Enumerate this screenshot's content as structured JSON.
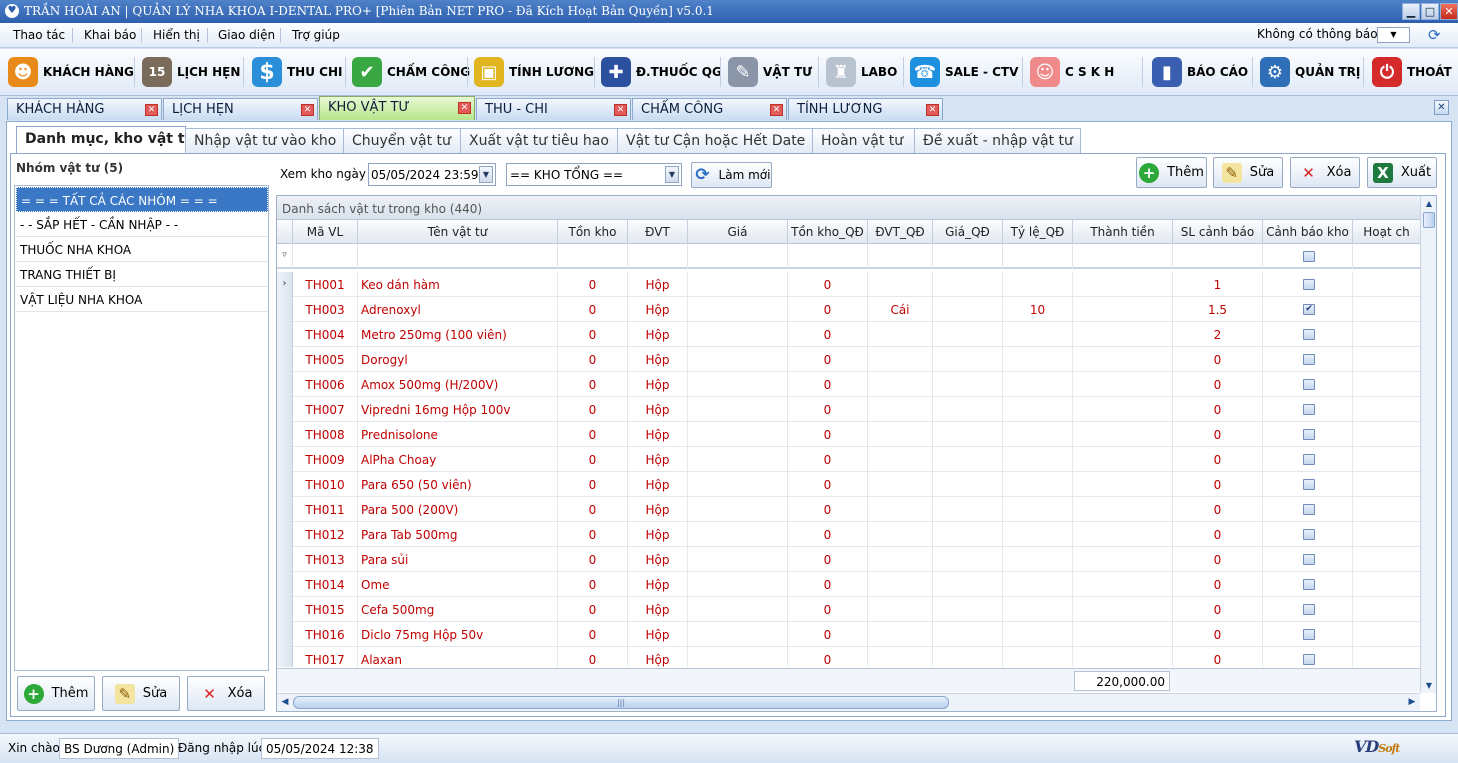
{
  "window": {
    "title": "TRẦN HOÀI AN | QUẢN LÝ NHA KHOA I-DENTAL PRO+ [Phiên Bản NET PRO - Đã Kích Hoạt Bản Quyền] v5.0.1",
    "buttons": {
      "minimize": "▁",
      "maximize": "□",
      "close": "✕"
    }
  },
  "menu": {
    "items": [
      "Thao tác",
      "Khai báo",
      "Hiển thị",
      "Giao diện",
      "Trợ giúp"
    ],
    "notification": "Không có thông báo"
  },
  "toolbar": {
    "items": [
      {
        "label": "KHÁCH HÀNG",
        "icon": "people-icon",
        "color": "#e88a1a"
      },
      {
        "label": "LỊCH HẸN",
        "icon": "calendar-icon",
        "color": "#7b6b5b"
      },
      {
        "label": "THU CHI",
        "icon": "dollar-icon",
        "color": "#2a8fd8"
      },
      {
        "label": "CHẤM CÔNG",
        "icon": "shield-check-icon",
        "color": "#3aa842"
      },
      {
        "label": "TÍNH LƯƠNG",
        "icon": "wallet-icon",
        "color": "#e0b520"
      },
      {
        "label": "Đ.THUỐC QG",
        "icon": "medicine-icon",
        "color": "#2c4fa0"
      },
      {
        "label": "VẬT TƯ",
        "icon": "syringe-icon",
        "color": "#8a96a8"
      },
      {
        "label": "LABO",
        "icon": "tooth-icon",
        "color": "#b9c3cf"
      },
      {
        "label": "SALE - CTV",
        "icon": "phone-icon",
        "color": "#1f8fe0"
      },
      {
        "label": "C S K H",
        "icon": "support-icon",
        "color": "#f08a8a"
      },
      {
        "label": "BÁO CÁO",
        "icon": "report-chart-icon",
        "color": "#3a5fb0"
      },
      {
        "label": "QUẢN TRỊ",
        "icon": "gear-icon",
        "color": "#2f6fb8"
      },
      {
        "label": "THOÁT",
        "icon": "power-icon",
        "color": "#d42a2a"
      }
    ]
  },
  "doc_tabs": [
    "KHÁCH HÀNG",
    "LỊCH HẸN",
    "KHO VẬT TƯ",
    "THU - CHI",
    "CHẤM CÔNG",
    "TÍNH LƯƠNG"
  ],
  "active_doc_tab": "KHO VẬT TƯ",
  "sub_tabs": [
    "Danh mục, kho vật tư",
    "Nhập vật tư vào kho",
    "Chuyển vật tư",
    "Xuất vật tư tiêu hao",
    "Vật tư Cận hoặc Hết Date",
    "Hoàn vật tư",
    "Đề xuất - nhập vật tư"
  ],
  "left": {
    "header": "Nhóm vật tư (5)",
    "groups": [
      "= = = TẤT CẢ CÁC NHÓM = = =",
      "- - SẮP HẾT - CẦN NHẬP - -",
      "THUỐC NHA KHOA",
      "TRANG THIẾT BỊ",
      "VẬT LIỆU NHA KHOA"
    ],
    "buttons": {
      "add": "Thêm",
      "edit": "Sửa",
      "delete": "Xóa"
    }
  },
  "filters": {
    "date_label": "Xem kho ngày",
    "date_value": "05/05/2024 23:59",
    "warehouse_value": "== KHO TỔNG ==",
    "refresh": "Làm mới"
  },
  "actions": {
    "add": "Thêm",
    "edit": "Sửa",
    "delete": "Xóa",
    "export": "Xuất"
  },
  "grid": {
    "caption": "Danh sách vật tư trong kho (440)",
    "columns": [
      "Mã VL",
      "Tên vật tư",
      "Tồn kho",
      "ĐVT",
      "Giá",
      "Tồn kho_QĐ",
      "ĐVT_QĐ",
      "Giá_QĐ",
      "Tỷ lệ_QĐ",
      "Thành tiền",
      "SL cảnh báo",
      "Cảnh báo kho",
      "Hoạt ch"
    ],
    "rows": [
      {
        "code": "TH001",
        "name": "Keo dán hàm",
        "stock": "0",
        "unit": "Hộp",
        "price": "",
        "stock_qd": "0",
        "unit_qd": "",
        "price_qd": "",
        "ratio_qd": "",
        "total": "",
        "warn_qty": "1",
        "warn": false
      },
      {
        "code": "TH003",
        "name": "Adrenoxyl",
        "stock": "0",
        "unit": "Hộp",
        "price": "",
        "stock_qd": "0",
        "unit_qd": "Cái",
        "price_qd": "",
        "ratio_qd": "10",
        "total": "",
        "warn_qty": "1.5",
        "warn": true
      },
      {
        "code": "TH004",
        "name": "Metro 250mg (100 viên)",
        "stock": "0",
        "unit": "Hộp",
        "price": "",
        "stock_qd": "0",
        "unit_qd": "",
        "price_qd": "",
        "ratio_qd": "",
        "total": "",
        "warn_qty": "2",
        "warn": false
      },
      {
        "code": "TH005",
        "name": "Dorogyl",
        "stock": "0",
        "unit": "Hộp",
        "price": "",
        "stock_qd": "0",
        "unit_qd": "",
        "price_qd": "",
        "ratio_qd": "",
        "total": "",
        "warn_qty": "0",
        "warn": false
      },
      {
        "code": "TH006",
        "name": "Amox 500mg (H/200V)",
        "stock": "0",
        "unit": "Hộp",
        "price": "",
        "stock_qd": "0",
        "unit_qd": "",
        "price_qd": "",
        "ratio_qd": "",
        "total": "",
        "warn_qty": "0",
        "warn": false
      },
      {
        "code": "TH007",
        "name": "Vipredni 16mg Hộp 100v",
        "stock": "0",
        "unit": "Hộp",
        "price": "",
        "stock_qd": "0",
        "unit_qd": "",
        "price_qd": "",
        "ratio_qd": "",
        "total": "",
        "warn_qty": "0",
        "warn": false
      },
      {
        "code": "TH008",
        "name": "Prednisolone",
        "stock": "0",
        "unit": "Hộp",
        "price": "",
        "stock_qd": "0",
        "unit_qd": "",
        "price_qd": "",
        "ratio_qd": "",
        "total": "",
        "warn_qty": "0",
        "warn": false
      },
      {
        "code": "TH009",
        "name": "AlPha Choay",
        "stock": "0",
        "unit": "Hộp",
        "price": "",
        "stock_qd": "0",
        "unit_qd": "",
        "price_qd": "",
        "ratio_qd": "",
        "total": "",
        "warn_qty": "0",
        "warn": false
      },
      {
        "code": "TH010",
        "name": "Para 650 (50 viên)",
        "stock": "0",
        "unit": "Hộp",
        "price": "",
        "stock_qd": "0",
        "unit_qd": "",
        "price_qd": "",
        "ratio_qd": "",
        "total": "",
        "warn_qty": "0",
        "warn": false
      },
      {
        "code": "TH011",
        "name": "Para 500 (200V)",
        "stock": "0",
        "unit": "Hộp",
        "price": "",
        "stock_qd": "0",
        "unit_qd": "",
        "price_qd": "",
        "ratio_qd": "",
        "total": "",
        "warn_qty": "0",
        "warn": false
      },
      {
        "code": "TH012",
        "name": "Para Tab 500mg",
        "stock": "0",
        "unit": "Hộp",
        "price": "",
        "stock_qd": "0",
        "unit_qd": "",
        "price_qd": "",
        "ratio_qd": "",
        "total": "",
        "warn_qty": "0",
        "warn": false
      },
      {
        "code": "TH013",
        "name": "Para sủi",
        "stock": "0",
        "unit": "Hộp",
        "price": "",
        "stock_qd": "0",
        "unit_qd": "",
        "price_qd": "",
        "ratio_qd": "",
        "total": "",
        "warn_qty": "0",
        "warn": false
      },
      {
        "code": "TH014",
        "name": "Ome",
        "stock": "0",
        "unit": "Hộp",
        "price": "",
        "stock_qd": "0",
        "unit_qd": "",
        "price_qd": "",
        "ratio_qd": "",
        "total": "",
        "warn_qty": "0",
        "warn": false
      },
      {
        "code": "TH015",
        "name": "Cefa 500mg",
        "stock": "0",
        "unit": "Hộp",
        "price": "",
        "stock_qd": "0",
        "unit_qd": "",
        "price_qd": "",
        "ratio_qd": "",
        "total": "",
        "warn_qty": "0",
        "warn": false
      },
      {
        "code": "TH016",
        "name": "Diclo 75mg Hộp 50v",
        "stock": "0",
        "unit": "Hộp",
        "price": "",
        "stock_qd": "0",
        "unit_qd": "",
        "price_qd": "",
        "ratio_qd": "",
        "total": "",
        "warn_qty": "0",
        "warn": false
      },
      {
        "code": "TH017",
        "name": "Alaxan",
        "stock": "0",
        "unit": "Hộp",
        "price": "",
        "stock_qd": "0",
        "unit_qd": "",
        "price_qd": "",
        "ratio_qd": "",
        "total": "",
        "warn_qty": "0",
        "warn": false
      }
    ],
    "footer_total": "220,000.00"
  },
  "status": {
    "greeting": "Xin chào",
    "user": "BS Dương (Admin)",
    "login_label": "Đăng nhập lúc",
    "login_time": "05/05/2024 12:38",
    "brand": "VDSoft"
  },
  "colors": {
    "accent": "#3a78c6",
    "data_text": "#c00000",
    "active_tab": "#b8e58a"
  }
}
